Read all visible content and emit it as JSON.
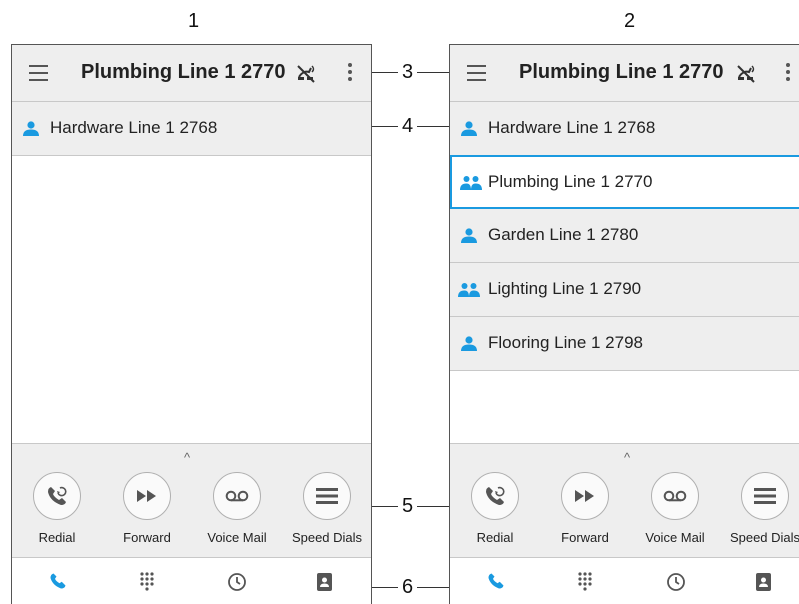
{
  "panels": [
    {
      "number": "1",
      "header": {
        "title": "Plumbing Line 1 2770"
      },
      "lines": [
        {
          "label": "Hardware Line 1 2768",
          "icon": "person-icon",
          "selected": false
        }
      ],
      "softkeys": [
        {
          "label": "Redial",
          "icon": "redial-icon"
        },
        {
          "label": "Forward",
          "icon": "forward-icon"
        },
        {
          "label": "Voice Mail",
          "icon": "voicemail-icon"
        },
        {
          "label": "Speed Dials",
          "icon": "speed-dials-icon"
        }
      ]
    },
    {
      "number": "2",
      "header": {
        "title": "Plumbing Line 1 2770"
      },
      "lines": [
        {
          "label": "Hardware Line 1 2768",
          "icon": "person-icon",
          "selected": false
        },
        {
          "label": "Plumbing Line 1 2770",
          "icon": "group-icon",
          "selected": true
        },
        {
          "label": "Garden Line 1 2780",
          "icon": "person-icon",
          "selected": false
        },
        {
          "label": "Lighting Line 1 2790",
          "icon": "group-icon",
          "selected": false
        },
        {
          "label": "Flooring Line 1 2798",
          "icon": "person-icon",
          "selected": false
        }
      ],
      "softkeys": [
        {
          "label": "Redial",
          "icon": "redial-icon"
        },
        {
          "label": "Forward",
          "icon": "forward-icon"
        },
        {
          "label": "Voice Mail",
          "icon": "voicemail-icon"
        },
        {
          "label": "Speed Dials",
          "icon": "speed-dials-icon"
        }
      ]
    }
  ],
  "navbar": [
    {
      "icon": "phone-icon",
      "active": true
    },
    {
      "icon": "dialpad-icon",
      "active": false
    },
    {
      "icon": "recents-icon",
      "active": false
    },
    {
      "icon": "contacts-icon",
      "active": false
    }
  ],
  "callouts": [
    "3",
    "4",
    "5",
    "6"
  ],
  "colors": {
    "accent": "#1a9ae0",
    "bar_bg": "#eeeeee",
    "icon_gray": "#555555"
  }
}
